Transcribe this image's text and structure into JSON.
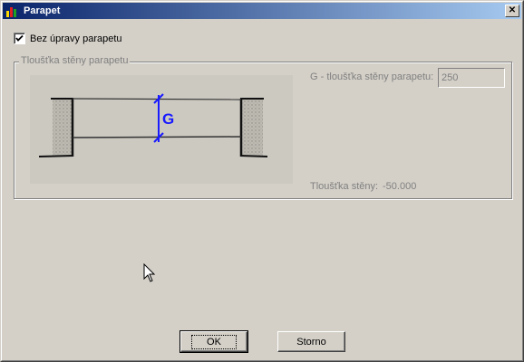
{
  "window": {
    "title": "Parapet",
    "close_glyph": "✕"
  },
  "checkbox": {
    "label": "Bez úpravy parapetu",
    "checked": true
  },
  "group": {
    "legend": "Tloušťka stěny parapetu"
  },
  "illustration": {
    "dimension_label": "G"
  },
  "fields": {
    "g_label": "G - tloušťka stěny parapetu:",
    "g_value": "250",
    "thickness_label": "Tloušťka stěny:",
    "thickness_value": "-50.000"
  },
  "buttons": {
    "ok": "OK",
    "cancel": "Storno"
  },
  "icons": {
    "app": "bar-chart-icon",
    "close": "close-icon",
    "cursor": "mouse-pointer-icon"
  },
  "colors": {
    "titlebar_start": "#0a246a",
    "titlebar_end": "#a6caf0",
    "dimension": "#1a1aff"
  }
}
